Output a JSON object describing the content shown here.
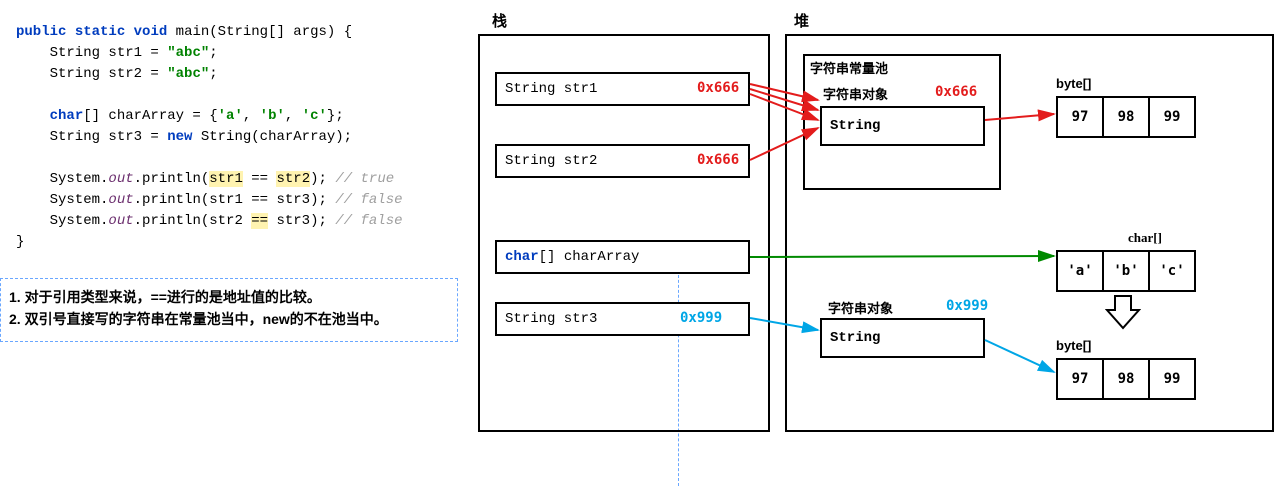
{
  "headings": {
    "stack": "栈",
    "heap": "堆",
    "pool": "字符串常量池",
    "strobj1": "字符串对象",
    "strobj2": "字符串对象",
    "byte1": "byte[]",
    "byte2": "byte[]",
    "char": "char[]"
  },
  "code": {
    "l1_kw1": "public",
    "l1_kw2": "static",
    "l1_kw3": "void",
    "l1_rest": " main(String[] args) {",
    "l2a": "    String str1 = ",
    "l2b": "\"abc\"",
    "l2c": ";",
    "l3a": "    String str2 = ",
    "l3b": "\"abc\"",
    "l3c": ";",
    "l4": " ",
    "l5_kw": "char",
    "l5_rest": "[] charArray = {",
    "l5_s1": "'a'",
    "l5_c1": ", ",
    "l5_s2": "'b'",
    "l5_c2": ", ",
    "l5_s3": "'c'",
    "l5_c3": "};",
    "l6a": "    String str3 = ",
    "l6_kw": "new",
    "l6b": " String(charArray);",
    "l7": " ",
    "l8a": "    System.",
    "l8_it": "out",
    "l8b": ".println(",
    "l8_h1": "str1",
    "l8b2": " == ",
    "l8_h2": "str2",
    "l8c": "); ",
    "l8_cmt": "// true",
    "l9a": "    System.",
    "l9_it": "out",
    "l9b": ".println(str1 == str3); ",
    "l9_cmt": "// false",
    "l10a": "    System.",
    "l10_it": "out",
    "l10b": ".println(str2 ",
    "l10_h": "==",
    "l10c": " str3); ",
    "l10_cmt": "// false",
    "l11": "}"
  },
  "notes": {
    "n1": "1. 对于引用类型来说，==进行的是地址值的比较。",
    "n2": "2. 双引号直接写的字符串在常量池当中，new的不在池当中。"
  },
  "stack": {
    "s1": "String str1",
    "s2": "String str2",
    "s3_a": "char",
    "s3_b": "[] charArray",
    "s4": "String str3"
  },
  "addr": {
    "a1": "0x666",
    "a2": "0x666",
    "a3": "0x666",
    "a4": "0x999",
    "a5": "0x999"
  },
  "heap": {
    "t1": "String",
    "t2": "String"
  },
  "arrays": {
    "b1": [
      "97",
      "98",
      "99"
    ],
    "c1": [
      "'a'",
      "'b'",
      "'c'"
    ],
    "b2": [
      "97",
      "98",
      "99"
    ]
  }
}
